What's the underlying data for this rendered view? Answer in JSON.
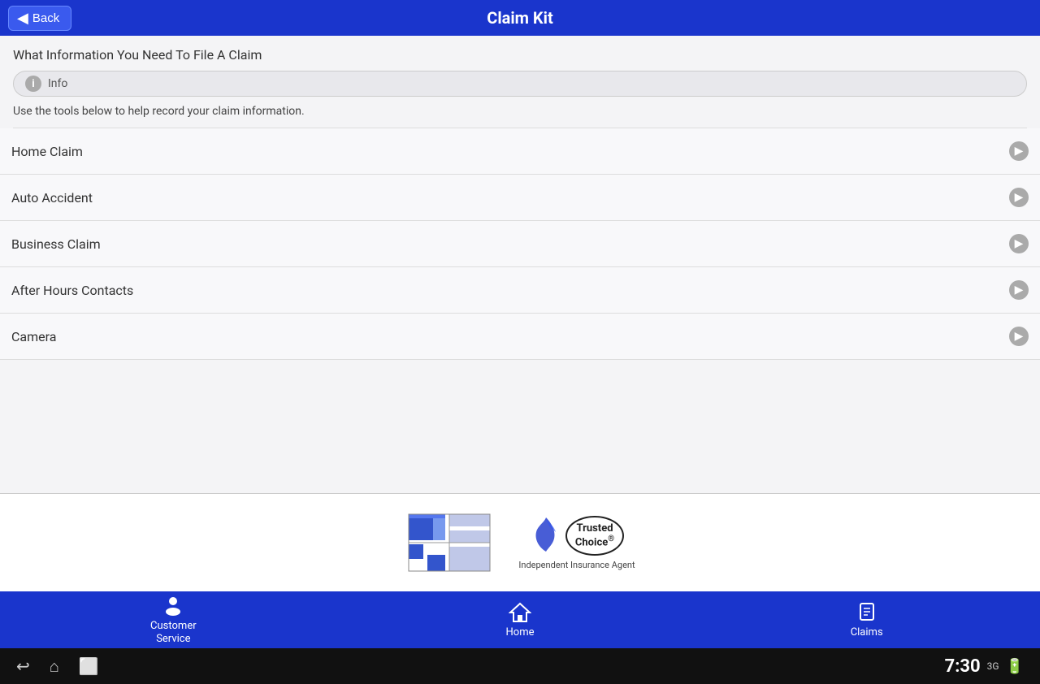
{
  "header": {
    "title": "Claim Kit",
    "back_label": "Back"
  },
  "page": {
    "title": "What Information You Need To File A Claim",
    "info_label": "Info",
    "info_description": "Use the tools below to help record your claim information."
  },
  "menu_items": [
    {
      "id": "home-claim",
      "label": "Home Claim"
    },
    {
      "id": "auto-accident",
      "label": "Auto Accident"
    },
    {
      "id": "business-claim",
      "label": "Business Claim"
    },
    {
      "id": "after-hours-contacts",
      "label": "After Hours Contacts"
    },
    {
      "id": "camera",
      "label": "Camera"
    }
  ],
  "branding": {
    "trusted_choice_line1": "Trusted",
    "trusted_choice_line2": "Choice",
    "reg_mark": "®",
    "independent_label": "Independent Insurance Agent"
  },
  "bottom_nav": [
    {
      "id": "customer-service",
      "label": "Customer\nService",
      "icon": "👤"
    },
    {
      "id": "home",
      "label": "Home",
      "icon": "🏠"
    },
    {
      "id": "claims",
      "label": "Claims",
      "icon": "📋"
    }
  ],
  "system": {
    "time": "7:30",
    "signal": "3G"
  }
}
